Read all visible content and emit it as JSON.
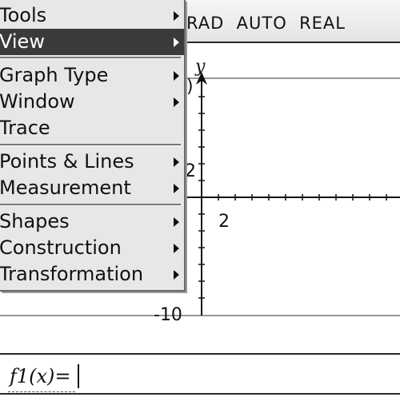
{
  "status_bar": {
    "text": "RAD  AUTO  REAL"
  },
  "graph": {
    "y_axis_label": "y",
    "tick_label_y_top": ")",
    "tick_label_y_2": "2",
    "tick_label_x_2": "2",
    "tick_label_y_neg10": "-10"
  },
  "menu": {
    "items": [
      {
        "label": "Tools",
        "has_submenu": true,
        "selected": false
      },
      {
        "label": "View",
        "has_submenu": true,
        "selected": true
      },
      {
        "label": "Graph Type",
        "has_submenu": true,
        "selected": false
      },
      {
        "label": "Window",
        "has_submenu": true,
        "selected": false
      },
      {
        "label": "Trace",
        "has_submenu": false,
        "selected": false
      },
      {
        "label": "Points & Lines",
        "has_submenu": true,
        "selected": false
      },
      {
        "label": "Measurement",
        "has_submenu": true,
        "selected": false
      },
      {
        "label": "Shapes",
        "has_submenu": true,
        "selected": false
      },
      {
        "label": "Construction",
        "has_submenu": true,
        "selected": false
      },
      {
        "label": "Transformation",
        "has_submenu": true,
        "selected": false
      }
    ]
  },
  "entry_line": {
    "prefix": "f1(x)=",
    "value": ""
  }
}
